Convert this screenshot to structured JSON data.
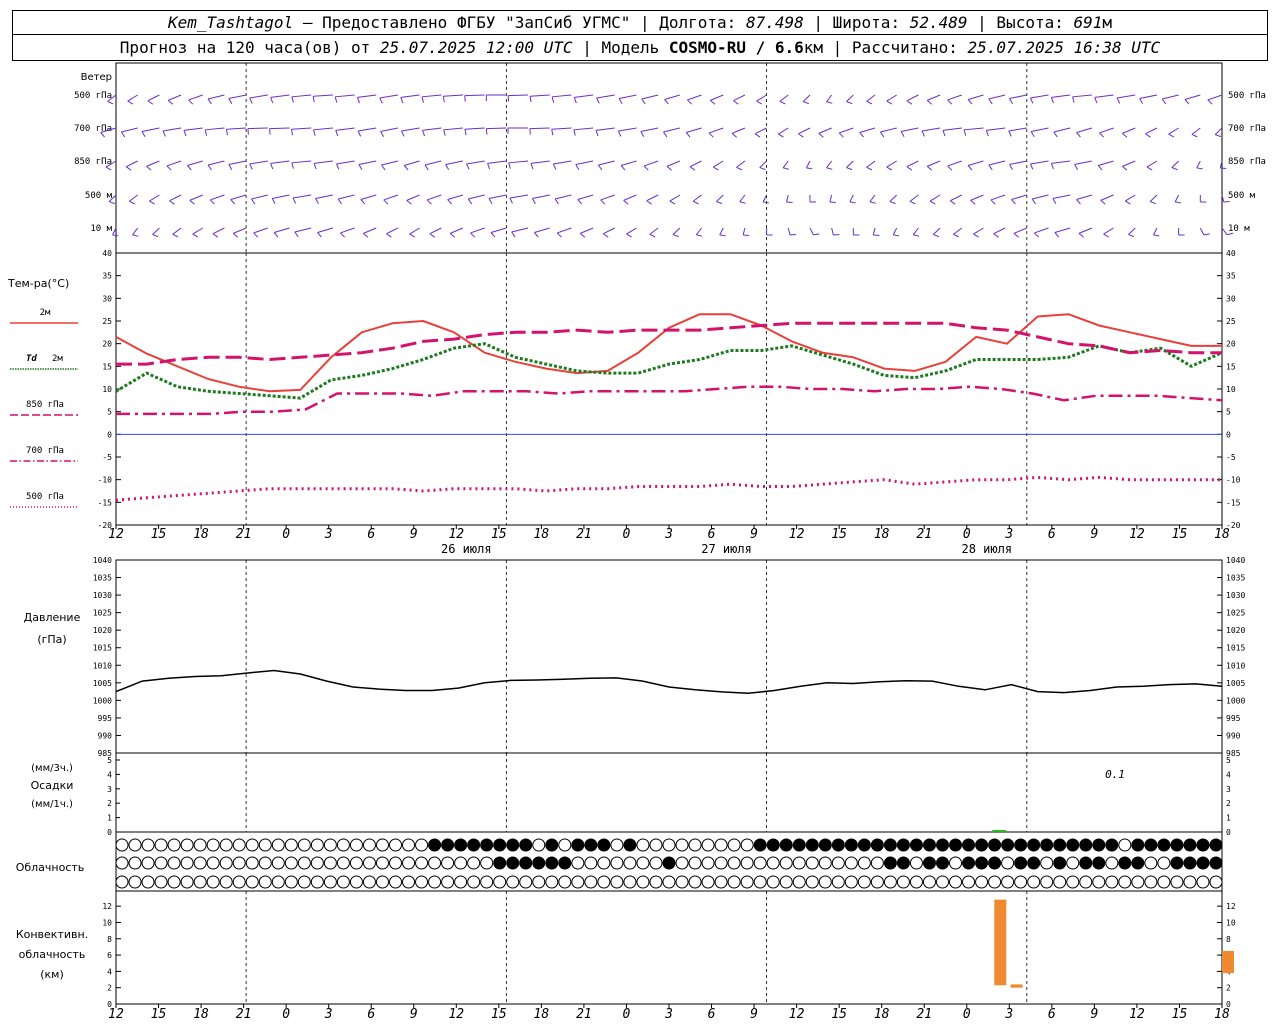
{
  "header": {
    "station": "Kem_Tashtagol",
    "provider": "— Предоставлено ФГБУ \"ЗапСиб УГМС\" | Долгота:",
    "lon": "87.498",
    "lat_label": "| Широта:",
    "lat": "52.489",
    "alt_label": "| Высота:",
    "alt": "691",
    "alt_unit": "м",
    "forecast_label": "Прогноз на 120 часа(ов) от",
    "start": "25.07.2025 12:00 UTC",
    "model_label": "| Модель",
    "model": "COSMO-RU / 6.6",
    "model_unit": "км",
    "calc_label": "| Рассчитано:",
    "calc": "25.07.2025 16:38 UTC"
  },
  "labels": {
    "wind": "Ветер",
    "levels": [
      "500 гПа",
      "700 гПа",
      "850 гПа",
      "500  м",
      "10   м"
    ],
    "temp_title": "Тем-ра(°С)",
    "t2m": "2м",
    "td": "Td",
    "td2": "2м",
    "t850": "850 гПа",
    "t700": "700 гПа",
    "t500": "500 гПа",
    "pressure": "Давление",
    "pressure_unit": "(гПа)",
    "precip_unit3": "(мм/3ч.)",
    "precip": "Осадки",
    "precip_unit1": "(мм/1ч.)",
    "cloud": "Облачность",
    "conv1": "Конвективн.",
    "conv2": "облачность",
    "conv3": "(км)",
    "precip_note": "0.1"
  },
  "colors": {
    "t2m": "#e8403a",
    "td": "#1e7a1e",
    "t850": "#d4126e",
    "t700": "#d4126e",
    "t500": "#d4126e",
    "wind": "#6a2ccc",
    "zero": "#3344ff",
    "precip": "#22bb22",
    "conv": "#f08a30",
    "pressure": "#000000"
  },
  "chart_data": {
    "type": "line",
    "x_hours_utc": [
      "12",
      "15",
      "18",
      "21",
      "0",
      "3",
      "6",
      "9",
      "12",
      "15",
      "18",
      "21",
      "0",
      "3",
      "6",
      "9",
      "12",
      "15",
      "18",
      "21",
      "0",
      "3",
      "6",
      "9",
      "12",
      "15",
      "18"
    ],
    "day_labels": [
      "26 июля",
      "27 июля",
      "28 июля"
    ],
    "temperature": {
      "ylim": [
        -20,
        40
      ],
      "yticks": [
        -20,
        -15,
        -10,
        -5,
        0,
        5,
        10,
        15,
        20,
        25,
        30,
        35,
        40
      ],
      "series": [
        {
          "name": "2м",
          "key": "t2m",
          "values": [
            21.5,
            17.8,
            15,
            12.2,
            10.5,
            9.5,
            9.8,
            17,
            22.5,
            24.5,
            25,
            22.5,
            18,
            16,
            14.5,
            13.5,
            14,
            18,
            23.5,
            26.5,
            26.5,
            24,
            20.5,
            18,
            17,
            14.5,
            14,
            16,
            21.5,
            20,
            26,
            26.5,
            24,
            22.5,
            21,
            19.5,
            19.5
          ]
        },
        {
          "name": "Td 2м",
          "key": "td",
          "values": [
            9.5,
            13.5,
            10.5,
            9.5,
            9,
            8.5,
            8,
            12,
            13,
            14.5,
            16.5,
            19,
            20,
            17,
            15.5,
            14,
            13.5,
            13.5,
            15.5,
            16.5,
            18.5,
            18.5,
            19.5,
            17.5,
            15.5,
            13,
            12.5,
            14,
            16.5,
            16.5,
            16.5,
            17,
            19.5,
            18,
            19,
            15,
            18
          ]
        },
        {
          "name": "850 гПа",
          "key": "t850",
          "values": [
            15.5,
            15.5,
            16.5,
            17,
            17,
            16.5,
            17,
            17.5,
            18,
            19,
            20.5,
            21,
            22,
            22.5,
            22.5,
            23,
            22.5,
            23,
            23,
            23,
            23.5,
            24,
            24.5,
            24.5,
            24.5,
            24.5,
            24.5,
            24.5,
            23.5,
            23,
            21.5,
            20,
            19.5,
            18,
            18.5,
            18,
            18
          ]
        },
        {
          "name": "700 гПа",
          "key": "t700",
          "values": [
            4.5,
            4.5,
            4.5,
            4.5,
            5,
            5,
            5.5,
            9,
            9,
            9,
            8.5,
            9.5,
            9.5,
            9.5,
            9,
            9.5,
            9.5,
            9.5,
            9.5,
            10,
            10.5,
            10.5,
            10,
            10,
            9.5,
            10,
            10,
            10.5,
            10,
            9,
            7.5,
            8.5,
            8.5,
            8.5,
            8,
            7.5
          ]
        },
        {
          "name": "500 гПа",
          "key": "t500",
          "values": [
            -14.5,
            -14,
            -13.5,
            -13,
            -12.5,
            -12,
            -12,
            -12,
            -12,
            -12,
            -12.5,
            -12,
            -12,
            -12,
            -12.5,
            -12,
            -12,
            -11.5,
            -11.5,
            -11.5,
            -11,
            -11.5,
            -11.5,
            -11,
            -10.5,
            -10,
            -11,
            -10.5,
            -10,
            -10,
            -9.5,
            -10,
            -9.5,
            -10,
            -10,
            -10,
            -10
          ]
        }
      ]
    },
    "pressure": {
      "ylim": [
        985,
        1040
      ],
      "yticks": [
        985,
        990,
        995,
        1000,
        1005,
        1010,
        1015,
        1020,
        1025,
        1030,
        1035,
        1040
      ],
      "values": [
        1002.5,
        1005.5,
        1006.3,
        1006.8,
        1007,
        1007.8,
        1008.5,
        1007.5,
        1005.5,
        1003.8,
        1003.2,
        1002.8,
        1002.8,
        1003.5,
        1005,
        1005.7,
        1005.8,
        1006,
        1006.3,
        1006.4,
        1005.5,
        1003.8,
        1003,
        1002.4,
        1002,
        1002.8,
        1004,
        1005,
        1004.8,
        1005.3,
        1005.6,
        1005.5,
        1004,
        1003,
        1004.5,
        1002.5,
        1002.2,
        1002.8,
        1003.8,
        1004,
        1004.5,
        1004.7,
        1004
      ]
    },
    "precip": {
      "ylim": [
        0,
        5
      ],
      "yticks": [
        0,
        1,
        2,
        3,
        4,
        5
      ],
      "bars": [
        {
          "hour_index": 27,
          "value": 0.1
        }
      ]
    },
    "cloud_rows": {
      "high": "0000000000000000000000001111111101011101000000000111111111111111111111111111101111111111111111111111",
      "mid": "0000000000000000000000000000011111100000001000000000000000011011011101101011011001111101011011111111",
      "low": "0000000000000000000000000000000000000000000000000000000000000000000000000000000000000000000000000000"
    },
    "convective": {
      "ylim": [
        0,
        13
      ],
      "yticks": [
        0,
        2,
        4,
        6,
        8,
        10,
        12
      ],
      "bars": [
        {
          "hour": 81,
          "base": 2.3,
          "top": 12.8
        },
        {
          "hour": 82.5,
          "base": 2.0,
          "top": 2.4
        },
        {
          "hour": 102,
          "base": 3.8,
          "top": 6.5
        }
      ]
    }
  }
}
